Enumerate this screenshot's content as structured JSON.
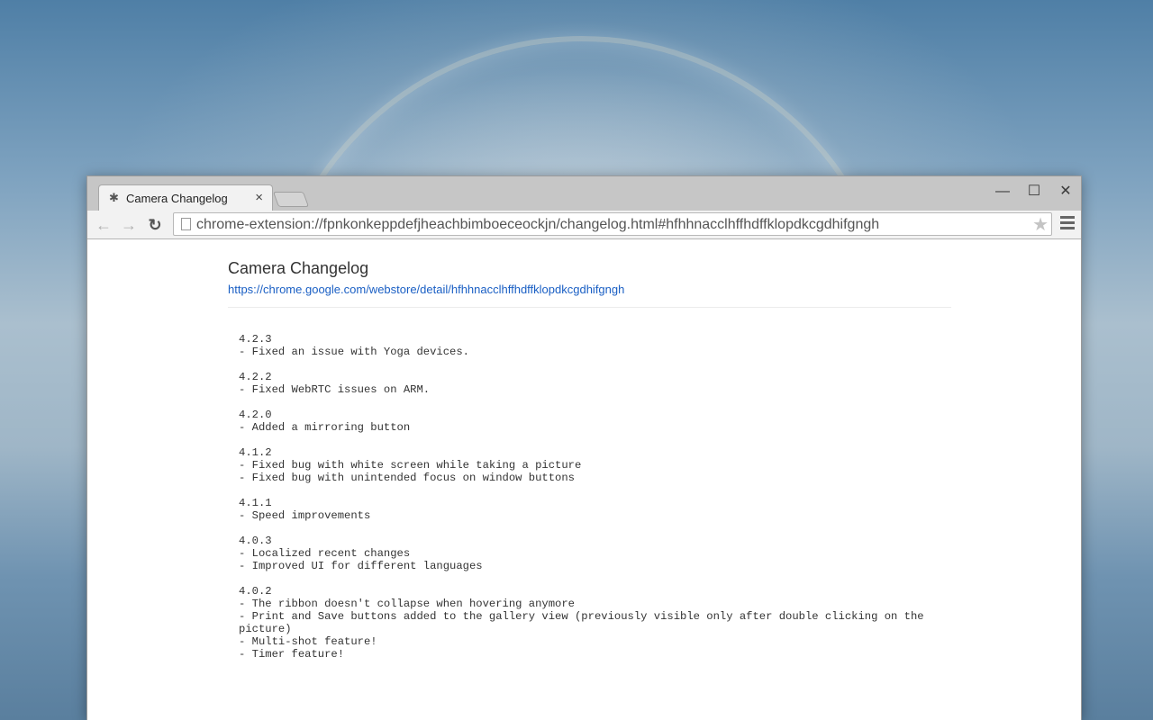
{
  "tab": {
    "title": "Camera Changelog",
    "close": "×"
  },
  "window_controls": {
    "minimize": "—",
    "maximize": "☐",
    "close": "✕"
  },
  "toolbar": {
    "back": "←",
    "forward": "→",
    "reload": "↻",
    "url": "chrome-extension://fpnkonkeppdefjheachbimboeceockjn/changelog.html#hfhhnacclhffhdffklopdkcgdhifgngh",
    "bookmark": "★"
  },
  "page": {
    "title": "Camera Changelog",
    "link": "https://chrome.google.com/webstore/detail/hfhhnacclhffhdffklopdkcgdhifgngh"
  },
  "changelog": [
    {
      "version": "4.2.3",
      "changes": [
        "- Fixed an issue with Yoga devices."
      ]
    },
    {
      "version": "4.2.2",
      "changes": [
        "- Fixed WebRTC issues on ARM."
      ]
    },
    {
      "version": "4.2.0",
      "changes": [
        "- Added a mirroring button"
      ]
    },
    {
      "version": "4.1.2",
      "changes": [
        "- Fixed bug with white screen while taking a picture",
        "- Fixed bug with unintended focus on window buttons"
      ]
    },
    {
      "version": "4.1.1",
      "changes": [
        "- Speed improvements"
      ]
    },
    {
      "version": "4.0.3",
      "changes": [
        "- Localized recent changes",
        "- Improved UI for different languages"
      ]
    },
    {
      "version": "4.0.2",
      "changes": [
        "- The ribbon doesn't collapse when hovering anymore",
        "- Print and Save buttons added to the gallery view (previously visible only after double clicking on the picture)",
        "- Multi-shot feature!",
        "- Timer feature!"
      ]
    }
  ]
}
